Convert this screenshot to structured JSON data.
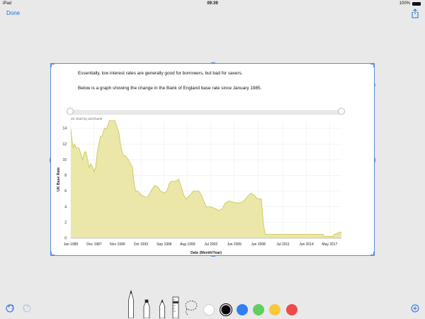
{
  "status": {
    "carrier": "iPad",
    "time": "09:39",
    "battery": "100%"
  },
  "nav": {
    "done_label": "Done"
  },
  "document": {
    "line1": "Essentially, low interest rates are generally good for borrowers, but bad for savers.",
    "line2": "Below is a graph showing the change in the Bank of England base rate since January 1985."
  },
  "chart_credit": "JS chart by amCharts",
  "chart_data": {
    "type": "area",
    "title": "",
    "xlabel": "Date (Month/Year)",
    "ylabel": "UK Base Rate",
    "ylim": [
      0,
      15
    ],
    "xlim": [
      1985.0,
      2018.8
    ],
    "yticks": [
      0,
      2,
      4,
      6,
      8,
      10,
      12,
      14
    ],
    "xticks": [
      {
        "label": "Jan 1985",
        "x": 1985.0
      },
      {
        "label": "Dec 1987",
        "x": 1987.92
      },
      {
        "label": "Nov 1990",
        "x": 1990.83
      },
      {
        "label": "Oct 1993",
        "x": 1993.75
      },
      {
        "label": "Sep 1996",
        "x": 1996.67
      },
      {
        "label": "Aug 1999",
        "x": 1999.58
      },
      {
        "label": "Jul 2002",
        "x": 2002.5
      },
      {
        "label": "Jun 2005",
        "x": 2005.42
      },
      {
        "label": "Jun 2008",
        "x": 2008.42
      },
      {
        "label": "Jul 2011",
        "x": 2011.5
      },
      {
        "label": "Jun 2014",
        "x": 2014.42
      },
      {
        "label": "May 2017",
        "x": 2017.33
      }
    ],
    "grid": true,
    "color": "#e6e39a",
    "line_color": "#c8c24a",
    "x": [
      1985.0,
      1985.15,
      1985.3,
      1985.45,
      1985.7,
      1986.0,
      1986.25,
      1986.45,
      1986.7,
      1986.9,
      1987.1,
      1987.3,
      1987.5,
      1987.75,
      1987.9,
      1988.1,
      1988.3,
      1988.5,
      1988.7,
      1988.9,
      1989.2,
      1989.5,
      1989.8,
      1990.2,
      1990.5,
      1990.8,
      1991.0,
      1991.2,
      1991.4,
      1991.6,
      1991.8,
      1992.2,
      1992.7,
      1992.9,
      1993.1,
      1993.4,
      1993.8,
      1994.3,
      1994.6,
      1995.0,
      1995.5,
      1995.9,
      1996.2,
      1996.7,
      1997.0,
      1997.3,
      1997.6,
      1998.0,
      1998.5,
      1998.8,
      1999.1,
      1999.4,
      1999.9,
      2000.3,
      2001.0,
      2001.3,
      2001.6,
      2001.9,
      2002.5,
      2003.1,
      2003.5,
      2003.9,
      2004.3,
      2004.8,
      2005.6,
      2006.2,
      2006.6,
      2007.0,
      2007.5,
      2007.9,
      2008.3,
      2008.8,
      2008.95,
      2009.1,
      2009.3,
      2012.0,
      2014.0,
      2016.5,
      2016.6,
      2017.8,
      2017.9,
      2018.6,
      2018.8
    ],
    "values": [
      13.9,
      12.5,
      11.5,
      12.0,
      11.5,
      11.5,
      10.8,
      10.0,
      11.0,
      11.0,
      10.0,
      9.0,
      9.5,
      9.0,
      8.5,
      9.0,
      11.0,
      12.0,
      13.0,
      13.0,
      14.0,
      14.0,
      15.0,
      15.0,
      15.0,
      14.0,
      13.5,
      12.0,
      11.0,
      10.5,
      10.5,
      10.0,
      9.0,
      7.0,
      6.0,
      6.0,
      5.5,
      5.25,
      5.25,
      6.0,
      6.75,
      6.5,
      6.0,
      5.75,
      6.0,
      7.0,
      7.25,
      7.25,
      7.5,
      6.5,
      5.5,
      5.0,
      5.5,
      6.0,
      6.0,
      5.5,
      4.75,
      4.0,
      4.0,
      3.75,
      3.5,
      3.75,
      4.5,
      4.75,
      4.5,
      4.5,
      4.75,
      5.25,
      5.75,
      5.5,
      5.0,
      5.0,
      3.0,
      1.5,
      0.5,
      0.5,
      0.5,
      0.5,
      0.25,
      0.25,
      0.5,
      0.75,
      0.75
    ]
  },
  "tools": {
    "pen": "pen-tool",
    "marker": "marker-tool",
    "pencil": "pencil-tool",
    "ruler": "ruler-tool",
    "lasso": "lasso-tool"
  },
  "colors": {
    "accent": "#1e6fd9",
    "swatches": [
      "#ffffff",
      "#000000",
      "#2f7ff0",
      "#5fcf5f",
      "#f6c93c",
      "#ef4a4a"
    ]
  }
}
